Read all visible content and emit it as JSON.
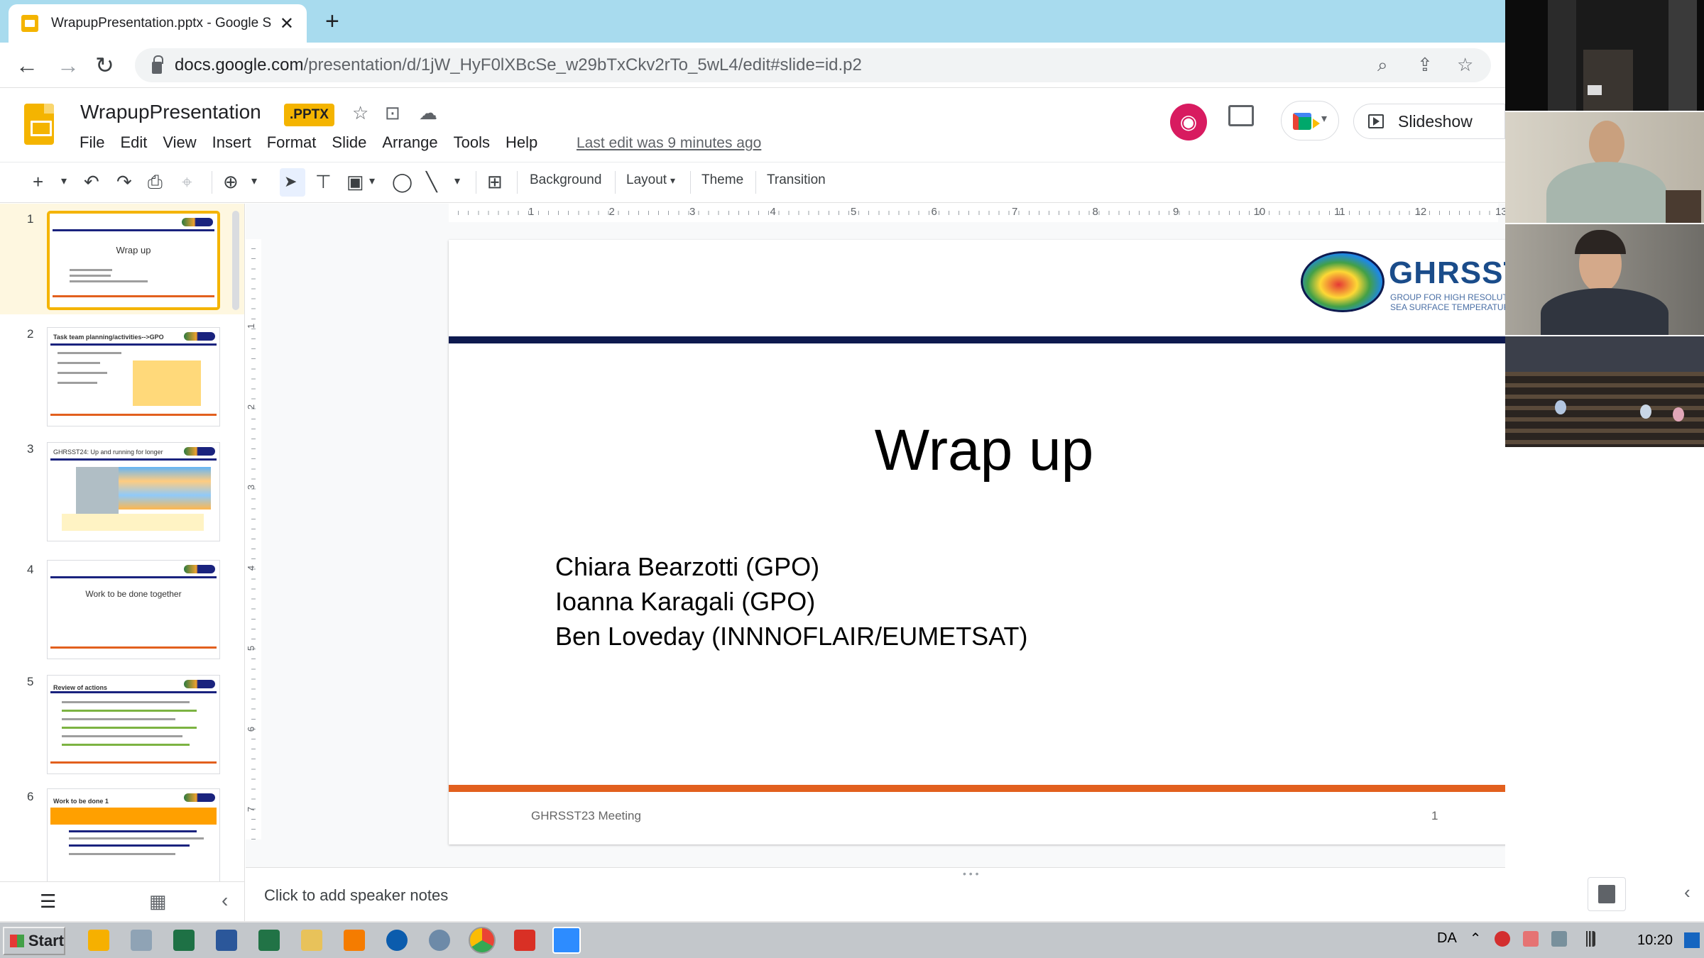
{
  "browser": {
    "tab_title": "WrapupPresentation.pptx - Google S",
    "tab_close": "✕",
    "new_tab": "+",
    "url_domain": "docs.google.com",
    "url_path": "/presentation/d/1jW_HyF0lXBcSe_w29bTxCkv2rTo_5wL4/edit#slide=id.p2",
    "back": "←",
    "forward": "→",
    "reload": "↻",
    "zoom_icon": "⌕",
    "share_icon": "⇪",
    "star_icon": "☆"
  },
  "app": {
    "title": "WrapupPresentation",
    "badge": ".PPTX",
    "star": "☆",
    "move": "⊡",
    "cloud": "☁",
    "menu": [
      "File",
      "Edit",
      "View",
      "Insert",
      "Format",
      "Slide",
      "Arrange",
      "Tools",
      "Help"
    ],
    "last_edit": "Last edit was 9 minutes ago",
    "avatar_glyph": "◉",
    "slideshow_label": "Slideshow",
    "slideshow_dd": "▾",
    "meet_dd": "▾"
  },
  "toolbar": {
    "new_slide": "+",
    "new_slide_dd": "▾",
    "undo": "↶",
    "redo": "↷",
    "print": "⎙",
    "paint": "⌖",
    "zoom": "⊕",
    "zoom_dd": "▾",
    "select": "➤",
    "textbox": "⊤",
    "image": "▣",
    "image_dd": "▾",
    "shape": "◯",
    "line": "╲",
    "line_dd": "▾",
    "comment": "⊞",
    "background": "Background",
    "layout": "Layout",
    "layout_dd": "▾",
    "theme": "Theme",
    "transition": "Transition"
  },
  "filmstrip": {
    "slides": [
      {
        "num": "1",
        "title": "Wrap up"
      },
      {
        "num": "2",
        "title": "Task team planning/activities-->GPO"
      },
      {
        "num": "3",
        "title": "GHRSST24: Up and running for longer"
      },
      {
        "num": "4",
        "title": "Work to be done together"
      },
      {
        "num": "5",
        "title": "Review of actions"
      },
      {
        "num": "6",
        "title": "Work to be done 1"
      }
    ],
    "list_icon": "☰",
    "grid_icon": "▦",
    "collapse_icon": "‹"
  },
  "rulers": {
    "h": [
      "1",
      "2",
      "3",
      "4",
      "5",
      "6",
      "7",
      "8",
      "9",
      "10",
      "11",
      "12",
      "13"
    ],
    "v": [
      "1",
      "2",
      "3",
      "4",
      "5",
      "6",
      "7"
    ]
  },
  "slide": {
    "logo_word": "GHRSST",
    "logo_sub1": "GROUP FOR HIGH RESOLUTION",
    "logo_sub2": "SEA SURFACE TEMPERATURE",
    "title": "Wrap up",
    "presenters": [
      "Chiara Bearzotti (GPO)",
      "Ioanna Karagali (GPO)",
      "Ben Loveday (INNNOFLAIR/EUMETSAT)"
    ],
    "footer_left": "GHRSST23 Meeting",
    "footer_right": "1"
  },
  "notes": {
    "placeholder": "Click to add speaker notes",
    "handle": "• • •"
  },
  "side": {
    "collapse": "‹"
  },
  "taskbar": {
    "start": "Start",
    "lang": "DA",
    "clock": "10:20",
    "caret": "⌃"
  },
  "colors": {
    "slides_yellow": "#f4b400",
    "slide_top_bar": "#0e1a4f",
    "slide_bottom_bar": "#e2601e",
    "avatar": "#d81b60"
  }
}
